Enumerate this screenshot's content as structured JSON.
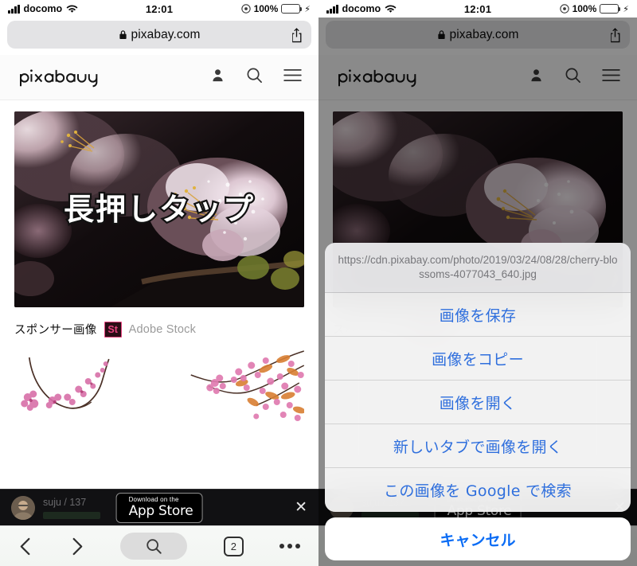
{
  "status_bar": {
    "carrier": "docomo",
    "wifi_icon": "wifi-icon",
    "time": "12:01",
    "battery_percent": "100%",
    "battery_fill_color": "#31d74b",
    "charging_icon": "lightning-bolt-icon",
    "rotation_lock_icon": "rotation-lock-icon"
  },
  "browser": {
    "url": "pixabay.com",
    "lock_icon": "lock-icon",
    "share_icon": "share-icon",
    "toolbar": {
      "back_icon": "chevron-left-icon",
      "forward_icon": "chevron-right-icon",
      "search_icon": "search-icon",
      "tab_count": "2",
      "more_icon": "ellipsis-icon"
    }
  },
  "site": {
    "logo_text": "pixabay",
    "account_icon": "person-icon",
    "search_icon": "search-icon",
    "menu_icon": "hamburger-menu-icon",
    "hero_caption": "長押しタップ",
    "sponsor_label": "スポンサー画像",
    "sponsor_badge": "St",
    "sponsor_name": "Adobe Stock",
    "sponsor_badge_color": "#e6447f"
  },
  "app_banner": {
    "username": "suju / 137",
    "badge_small": "Download on the",
    "badge_large": "App Store",
    "apple_icon": "apple-logo-icon",
    "close_icon": "close-icon"
  },
  "action_sheet": {
    "url": "https://cdn.pixabay.com/photo/2019/03/24/08/28/cherry-blossoms-4077043_640.jpg",
    "items": [
      {
        "label": "画像を保存",
        "name": "save-image"
      },
      {
        "label": "画像をコピー",
        "name": "copy-image"
      },
      {
        "label": "画像を開く",
        "name": "open-image"
      },
      {
        "label": "新しいタブで画像を開く",
        "name": "open-image-new-tab"
      },
      {
        "label": "この画像を Google で検索",
        "name": "search-image-google"
      }
    ],
    "cancel_label": "キャンセル",
    "accent_color": "#2f6fdd"
  }
}
